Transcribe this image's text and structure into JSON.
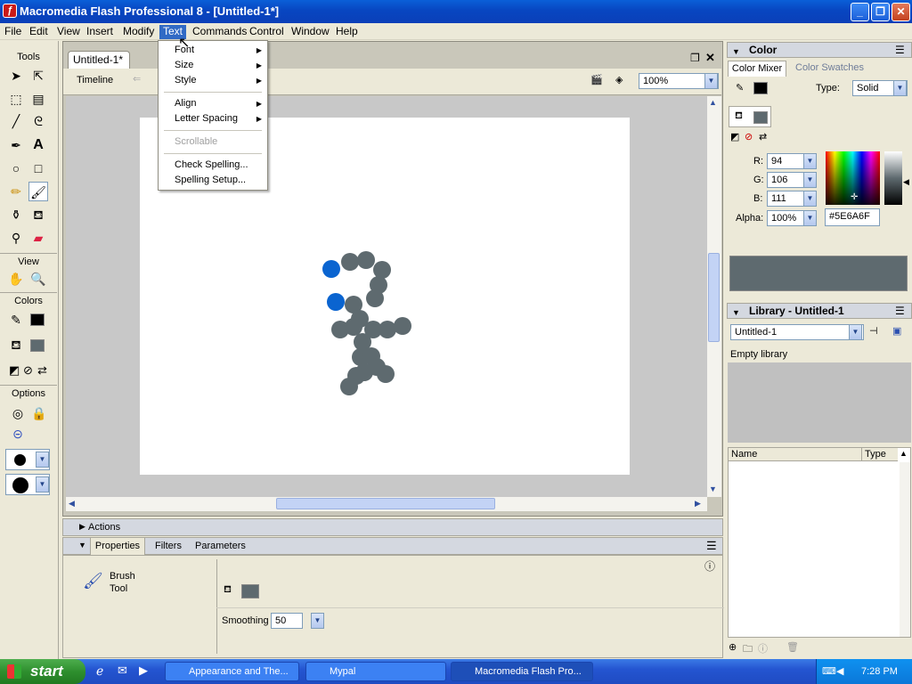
{
  "window": {
    "title": "Macromedia Flash Professional 8 - [Untitled-1*]"
  },
  "menubar": [
    "File",
    "Edit",
    "View",
    "Insert",
    "Modify",
    "Text",
    "Commands",
    "Control",
    "Window",
    "Help"
  ],
  "text_menu": {
    "font": "Font",
    "size": "Size",
    "style": "Style",
    "align": "Align",
    "letter_spacing": "Letter Spacing",
    "scrollable": "Scrollable",
    "check_spelling": "Check Spelling...",
    "spelling_setup": "Spelling Setup..."
  },
  "tools": {
    "title": "Tools",
    "view": "View",
    "colors": "Colors",
    "options": "Options"
  },
  "document": {
    "tab": "Untitled-1*",
    "timeline": "Timeline",
    "zoom": "100%"
  },
  "panels": {
    "actions": "Actions",
    "properties": "Properties",
    "filters": "Filters",
    "parameters": "Parameters"
  },
  "properties": {
    "tool_name_1": "Brush",
    "tool_name_2": "Tool",
    "smoothing_label": "Smoothing",
    "smoothing_value": "50"
  },
  "color_panel": {
    "title": "Color",
    "tab_mixer": "Color Mixer",
    "tab_swatches": "Color Swatches",
    "type_label": "Type:",
    "type_value": "Solid",
    "r_label": "R:",
    "r": "94",
    "g_label": "G:",
    "g": "106",
    "b_label": "B:",
    "b": "111",
    "alpha_label": "Alpha:",
    "alpha": "100%",
    "hex": "#5E6A6F",
    "fill_color": "#5E6A6F"
  },
  "library_panel": {
    "title": "Library - Untitled-1",
    "doc": "Untitled-1",
    "empty": "Empty library",
    "col_name": "Name",
    "col_type": "Type"
  },
  "taskbar": {
    "start": "start",
    "tasks": [
      "Appearance and The...",
      "Mypal",
      "Macromedia Flash Pro..."
    ],
    "clock": "7:28 PM"
  }
}
